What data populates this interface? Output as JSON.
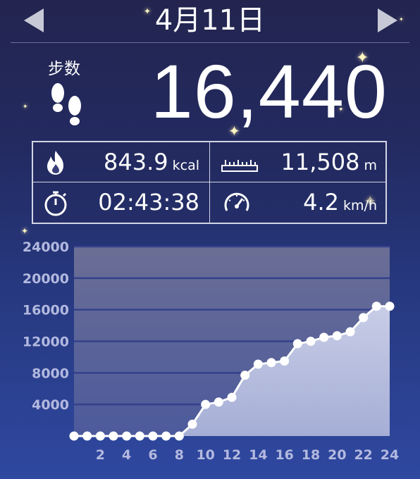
{
  "header": {
    "date": "4月11日"
  },
  "summary": {
    "steps_label": "步数",
    "steps_value": "16,440"
  },
  "stats": {
    "calories": {
      "value": "843.9",
      "unit": "kcal",
      "icon": "flame-icon"
    },
    "distance": {
      "value": "11,508",
      "unit": "m",
      "icon": "ruler-icon"
    },
    "time": {
      "value": "02:43:38",
      "unit": "",
      "icon": "stopwatch-icon"
    },
    "speed": {
      "value": "4.2",
      "unit": "km/h",
      "icon": "speedometer-icon"
    }
  },
  "colors": {
    "background_top": "#23254f",
    "background_bottom": "#2f48a0",
    "plot_top": "#6b6e95",
    "plot_bottom": "#a6aed6",
    "line": "#ffffff"
  },
  "chart_data": {
    "type": "area",
    "title": "",
    "xlabel": "",
    "ylabel": "",
    "x": [
      0,
      1,
      2,
      3,
      4,
      5,
      6,
      7,
      8,
      9,
      10,
      11,
      12,
      13,
      14,
      15,
      16,
      17,
      18,
      19,
      20,
      21,
      22,
      23,
      24
    ],
    "series": [
      {
        "values": [
          0,
          0,
          0,
          0,
          0,
          0,
          0,
          0,
          0,
          1500,
          4000,
          4300,
          4900,
          7700,
          9100,
          9300,
          9500,
          11700,
          12000,
          12500,
          12700,
          13200,
          15000,
          16440,
          16440
        ]
      }
    ],
    "x_tick_labels": [
      "2",
      "4",
      "6",
      "8",
      "10",
      "12",
      "14",
      "16",
      "18",
      "20",
      "22",
      "24"
    ],
    "y_tick_labels": [
      "4000",
      "8000",
      "12000",
      "16000",
      "20000",
      "24000"
    ],
    "xlim": [
      0,
      24
    ],
    "ylim": [
      0,
      24000
    ],
    "grid": true
  }
}
